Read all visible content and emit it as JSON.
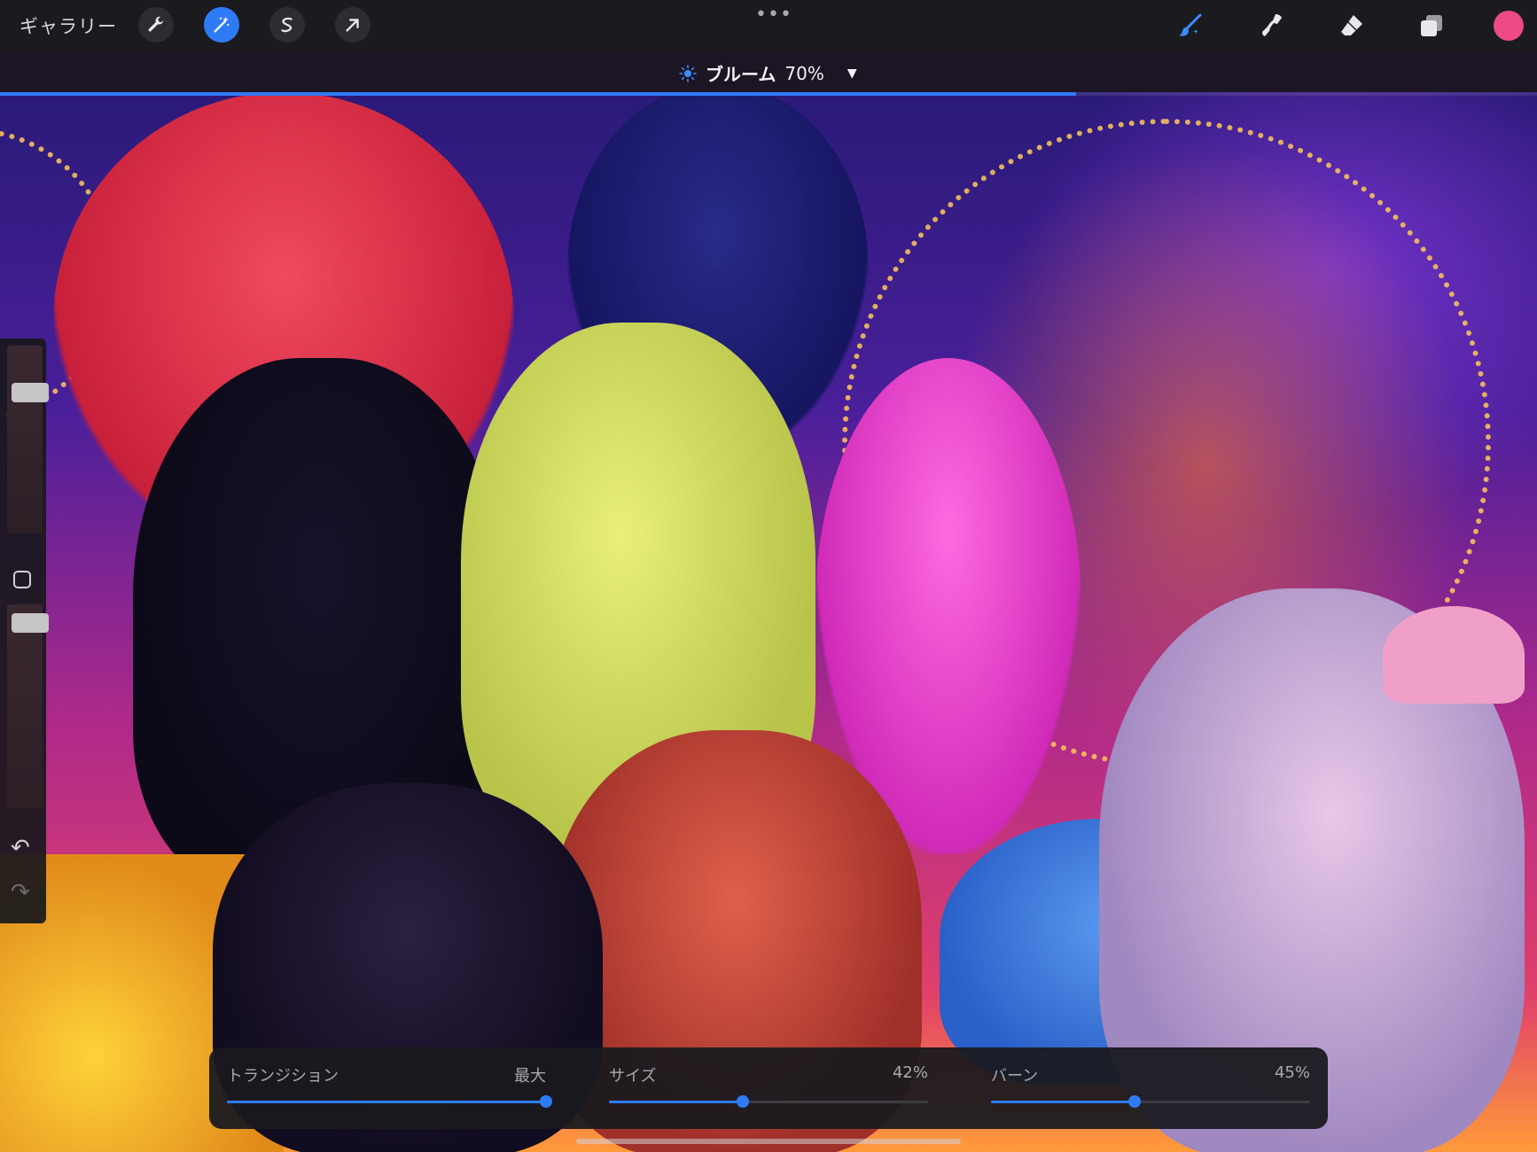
{
  "toolbar": {
    "gallery_label": "ギャラリー",
    "left_tools": [
      {
        "icon": "wrench-icon",
        "active": false
      },
      {
        "icon": "magic-wand-icon",
        "active": true
      },
      {
        "icon": "selection-s-icon",
        "active": false
      },
      {
        "icon": "transform-arrow-icon",
        "active": false
      }
    ],
    "more_label": "•••",
    "right_tools": [
      "brush-icon",
      "smudge-icon",
      "eraser-icon",
      "layers-icon"
    ],
    "current_color": "#ee4a86"
  },
  "adjustment": {
    "name": "ブルーム",
    "value_label": "70%",
    "value": 0.7,
    "dropdown_arrow": "▼"
  },
  "sidebar": {
    "size_slider_value": 0.78,
    "opacity_slider_value": 0.95,
    "undo_glyph": "↶",
    "redo_glyph": "↷"
  },
  "panel": {
    "sliders": [
      {
        "label": "トランジション",
        "value_label": "最大",
        "value": 1.0
      },
      {
        "label": "サイズ",
        "value_label": "42%",
        "value": 0.42
      },
      {
        "label": "バーン",
        "value_label": "45%",
        "value": 0.45
      }
    ]
  },
  "colors": {
    "accent": "#2f7bf6",
    "toolbar_bg": "#1b1b1f",
    "color_well": "#ee4a86"
  }
}
